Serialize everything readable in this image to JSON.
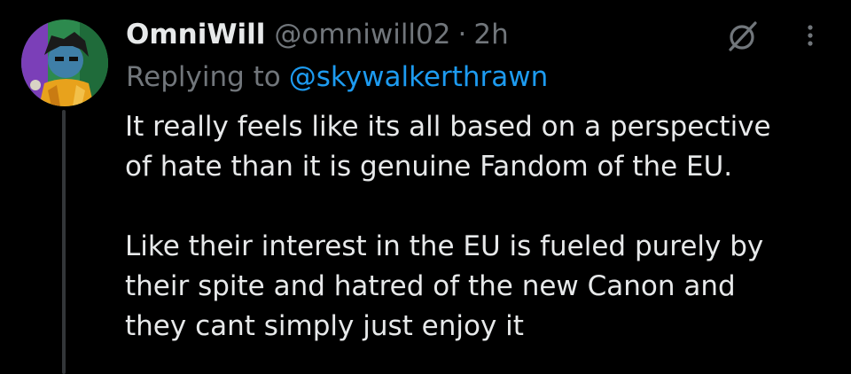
{
  "tweet": {
    "author": {
      "display_name": "OmniWill",
      "handle": "@omniwill02",
      "avatar_icon": "profile-avatar-illustration"
    },
    "separator": "·",
    "timestamp": "2h",
    "reply": {
      "prefix": "Replying to",
      "mention": "@skywalkerthrawn"
    },
    "body": {
      "paragraph1_lines": [
        "It really feels like its all based on a perspective",
        "of hate than it is genuine Fandom of the EU."
      ],
      "paragraph2_lines": [
        "Like their interest in the EU is fueled purely by",
        "their spite and hatred of the new Canon and",
        "they cant simply just enjoy it"
      ]
    },
    "icons": {
      "grok": "grok-icon",
      "more": "more-options-icon"
    }
  },
  "colors": {
    "background": "#000000",
    "primary_text": "#e7e9ea",
    "secondary_text": "#71767b",
    "link": "#1d9bf0",
    "thread_line": "#333639"
  }
}
